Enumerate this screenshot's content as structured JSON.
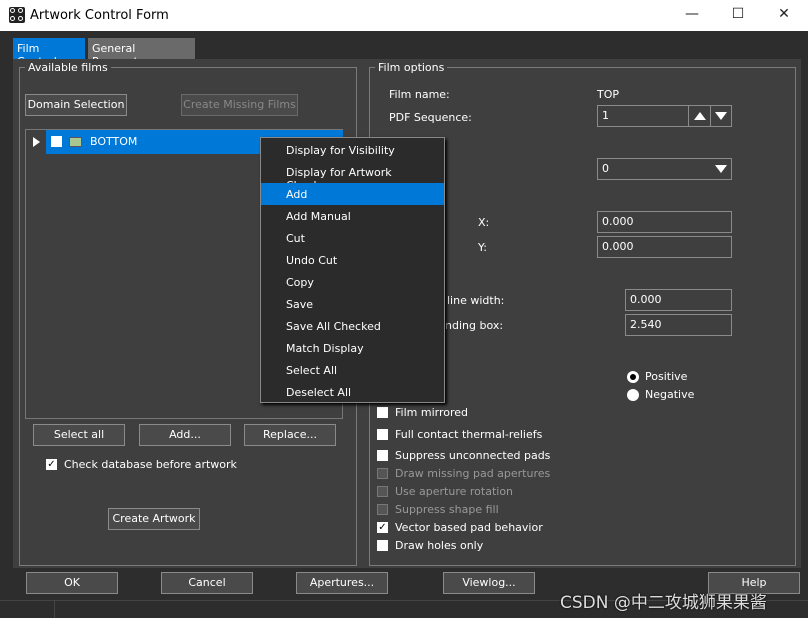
{
  "window": {
    "title": "Artwork Control Form",
    "min": "—",
    "max": "☐",
    "close": "✕"
  },
  "tabs": [
    {
      "label": "Film Control",
      "active": true
    },
    {
      "label": "General Parameters",
      "active": false
    }
  ],
  "left": {
    "group_label": "Available films",
    "domain_selection": "Domain Selection",
    "create_missing": "Create Missing Films",
    "tree": [
      {
        "label": "BOTTOM",
        "checked": false,
        "selected": true
      }
    ],
    "select_all": "Select all",
    "add": "Add...",
    "replace": "Replace...",
    "check_db": "Check database before artwork",
    "check_db_checked": true,
    "create_artwork": "Create Artwork"
  },
  "context_menu": {
    "items": [
      "Display for Visibility",
      "Display for Artwork Check",
      "Add",
      "Add Manual",
      "Cut",
      "Undo Cut",
      "Copy",
      "Save",
      "Save All Checked",
      "Match Display",
      "Select All",
      "Deselect All"
    ],
    "selected": "Add"
  },
  "right": {
    "group_label": "Film options",
    "film_name_label": "Film name:",
    "film_name": "TOP",
    "pdf_seq_label": "PDF Sequence:",
    "pdf_seq": "1",
    "rotation": "0",
    "x_label": "X:",
    "x": "0.000",
    "y_label": "Y:",
    "y": "0.000",
    "line_width_label": "line width:",
    "line_width": "0.000",
    "bbox_label": "nding box:",
    "bbox": "2.540",
    "positive": "Positive",
    "negative": "Negative",
    "polarity": "Positive",
    "options": [
      {
        "label": "Film mirrored",
        "checked": false,
        "enabled": true
      },
      {
        "label": "Full contact thermal-reliefs",
        "checked": false,
        "enabled": true
      },
      {
        "label": "Suppress unconnected pads",
        "checked": false,
        "enabled": true
      },
      {
        "label": "Draw missing pad apertures",
        "checked": false,
        "enabled": false
      },
      {
        "label": "Use aperture rotation",
        "checked": false,
        "enabled": false
      },
      {
        "label": "Suppress shape fill",
        "checked": false,
        "enabled": false
      },
      {
        "label": "Vector based pad behavior",
        "checked": true,
        "enabled": true
      },
      {
        "label": "Draw holes only",
        "checked": false,
        "enabled": true
      }
    ]
  },
  "buttons": {
    "ok": "OK",
    "cancel": "Cancel",
    "apertures": "Apertures...",
    "viewlog": "Viewlog...",
    "help": "Help"
  },
  "watermark": "CSDN @中二攻城狮果果酱",
  "colors": {
    "accent": "#0078d7",
    "panel": "#3f3f3f"
  }
}
